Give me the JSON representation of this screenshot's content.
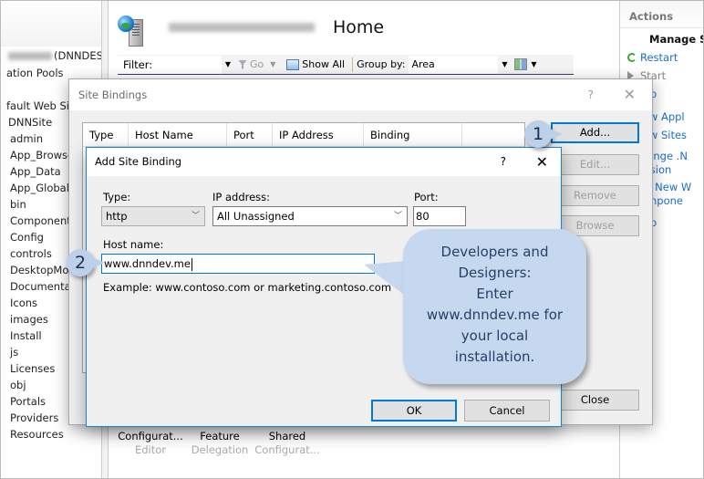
{
  "tree": {
    "server_suffix": "(DNNDES",
    "items": [
      "ation Pools",
      "fault Web Site",
      "DNNSite",
      "admin",
      "App_Browse",
      "App_Data",
      "App_GlobalR",
      "bin",
      "Component",
      "Config",
      "controls",
      "DesktopMo",
      "Documentat",
      "Icons",
      "images",
      "Install",
      "js",
      "Licenses",
      "obj",
      "Portals",
      "Providers",
      "Resources"
    ]
  },
  "main": {
    "title": "Home",
    "filter_label": "Filter:",
    "go_label": "Go",
    "show_all_label": "Show All",
    "group_by_label": "Group by:",
    "group_by_value": "Area",
    "features": [
      {
        "line1": "Configurat...",
        "line2": "Editor"
      },
      {
        "line1": "Feature",
        "line2": "Delegation"
      },
      {
        "line1": "Shared",
        "line2": "Configurat..."
      }
    ]
  },
  "actions": {
    "header": "Actions",
    "manage": "Manage S",
    "restart": "Restart",
    "start": "Start",
    "stop": "Stop",
    "view_app": "View Appl",
    "view_sites": "View Sites",
    "change_1": "Change .N",
    "change_2": "Version",
    "get_new_1": "Get New W",
    "get_new_2": "Compone",
    "help": "Help"
  },
  "site_bindings": {
    "title": "Site Bindings",
    "help": "?",
    "close": "✕",
    "columns": [
      "Type",
      "Host Name",
      "Port",
      "IP Address",
      "Binding Informa..."
    ],
    "buttons": {
      "add": "Add...",
      "edit": "Edit...",
      "remove": "Remove",
      "browse": "Browse",
      "close": "Close"
    }
  },
  "add_site_binding": {
    "title": "Add Site Binding",
    "help": "?",
    "close": "✕",
    "type_label": "Type:",
    "type_value": "http",
    "ip_label": "IP address:",
    "ip_value": "All Unassigned",
    "port_label": "Port:",
    "port_value": "80",
    "host_label": "Host name:",
    "host_value": "www.dnndev.me",
    "example": "Example: www.contoso.com or marketing.contoso.com",
    "ok": "OK",
    "cancel": "Cancel"
  },
  "callouts": {
    "step1": "1",
    "step2": "2",
    "bubble_lines": [
      "Developers and",
      "Designers:",
      "Enter",
      "www.dnndev.me for",
      "your local",
      "installation."
    ]
  }
}
